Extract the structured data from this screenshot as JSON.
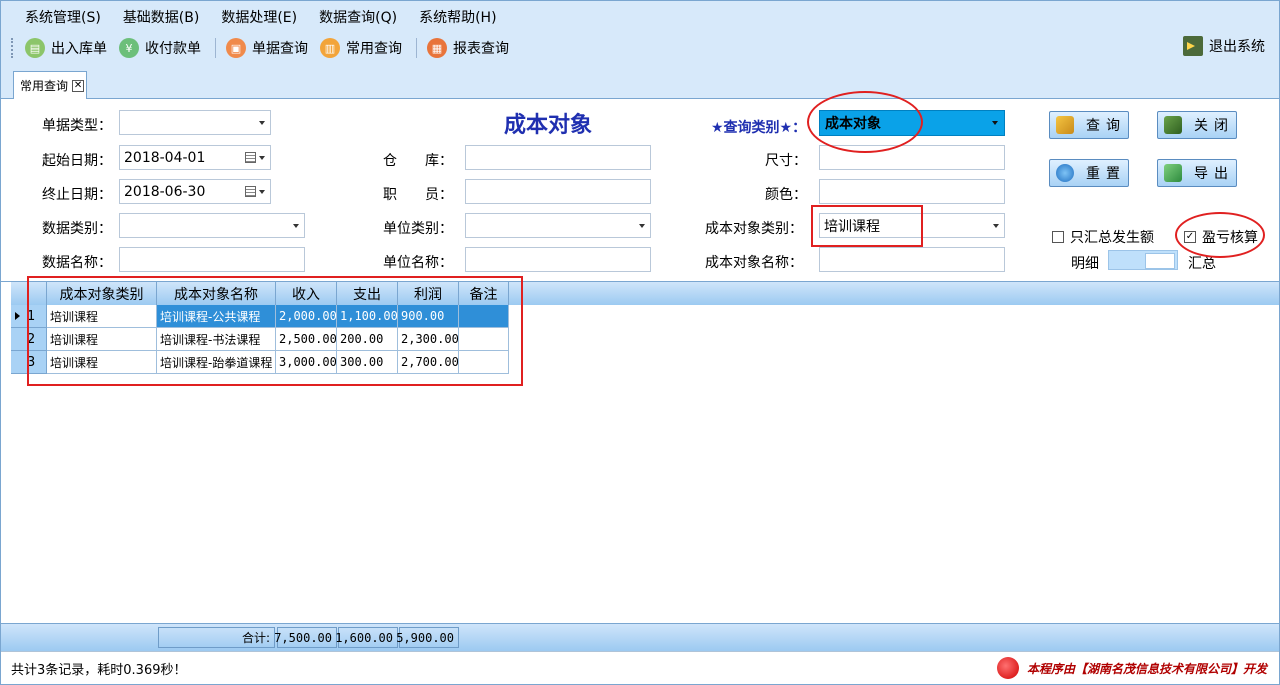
{
  "menu": [
    "系统管理(S)",
    "基础数据(B)",
    "数据处理(E)",
    "数据查询(Q)",
    "系统帮助(H)"
  ],
  "toolbar": {
    "items": [
      "出入库单",
      "收付款单",
      "单据查询",
      "常用查询",
      "报表查询"
    ],
    "exit": "退出系统"
  },
  "tab": {
    "label": "常用查询",
    "close": "✕"
  },
  "form": {
    "title": "成本对象",
    "doc_type_label": "单据类型：",
    "doc_type_value": "",
    "start_label": "起始日期：",
    "start_value": "2018-04-01",
    "end_label": "终止日期：",
    "end_value": "2018-06-30",
    "data_cat_label": "数据类别：",
    "data_name_label": "数据名称：",
    "warehouse_label": "仓　　库：",
    "staff_label": "职　　员：",
    "unit_cat_label": "单位类别：",
    "unit_name_label": "单位名称：",
    "query_type_label": "★查询类别★：",
    "query_type_value": "成本对象",
    "size_label": "尺寸：",
    "color_label": "颜色：",
    "obj_cat_label": "成本对象类别：",
    "obj_cat_value": "培训课程",
    "obj_name_label": "成本对象名称：",
    "btn_query": "查询",
    "btn_close": "关闭",
    "btn_reset": "重置",
    "btn_export": "导出",
    "only_summary_label": "只汇总发生额",
    "profit_label": "盈亏核算",
    "check_mark": "✓",
    "detail_label": "明细",
    "summary_label": "汇总"
  },
  "grid": {
    "headers": [
      "成本对象类别",
      "成本对象名称",
      "收入",
      "支出",
      "利润",
      "备注"
    ],
    "rows": [
      {
        "no": "1",
        "cat": "培训课程",
        "name": "培训课程-公共课程",
        "income": "2,000.00",
        "expense": "1,100.00",
        "profit": "900.00",
        "note": ""
      },
      {
        "no": "2",
        "cat": "培训课程",
        "name": "培训课程-书法课程",
        "income": "2,500.00",
        "expense": "200.00",
        "profit": "2,300.00",
        "note": ""
      },
      {
        "no": "3",
        "cat": "培训课程",
        "name": "培训课程-跆拳道课程",
        "income": "3,000.00",
        "expense": "300.00",
        "profit": "2,700.00",
        "note": ""
      }
    ],
    "totals_label": "合计:",
    "totals": {
      "income": "7,500.00",
      "expense": "1,600.00",
      "profit": "5,900.00"
    }
  },
  "status": {
    "left": "共计3条记录，耗时0.369秒！",
    "right": "本程序由【湖南名茂信息技术有限公司】开发"
  },
  "colors": {
    "accent": "#1f2fb0",
    "highlight": "#0aa2e8",
    "annotation": "#e02020"
  }
}
